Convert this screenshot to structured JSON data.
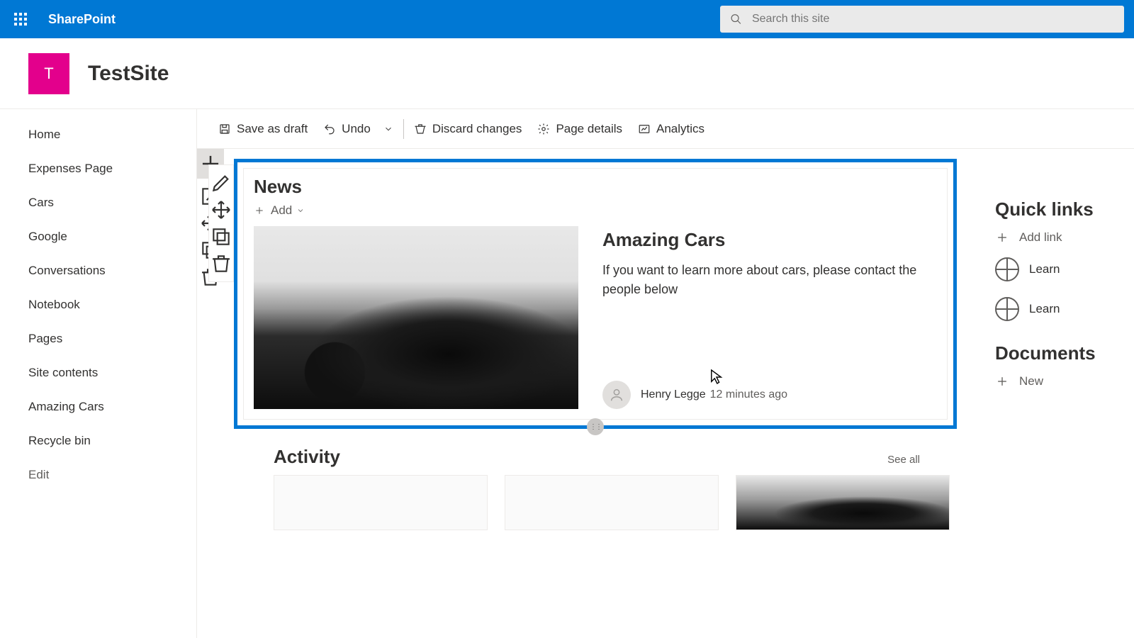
{
  "topbar": {
    "brand": "SharePoint"
  },
  "search": {
    "placeholder": "Search this site"
  },
  "site": {
    "initial": "T",
    "name": "TestSite"
  },
  "nav": {
    "items": [
      "Home",
      "Expenses Page",
      "Cars",
      "Google",
      "Conversations",
      "Notebook",
      "Pages",
      "Site contents",
      "Amazing Cars",
      "Recycle bin"
    ],
    "edit": "Edit"
  },
  "cmd": {
    "save": "Save as draft",
    "undo": "Undo",
    "discard": "Discard changes",
    "pagedetails": "Page details",
    "analytics": "Analytics"
  },
  "news": {
    "title": "News",
    "add": "Add",
    "post": {
      "title": "Amazing Cars",
      "desc": "If you want to learn more about cars, please contact the people below",
      "author": "Henry Legge",
      "time": "12 minutes ago"
    }
  },
  "activity": {
    "title": "Activity",
    "seeall": "See all"
  },
  "right": {
    "quicklinks_title": "Quick links",
    "addlink": "Add link",
    "learn": "Learn",
    "documents_title": "Documents",
    "new": "New"
  }
}
